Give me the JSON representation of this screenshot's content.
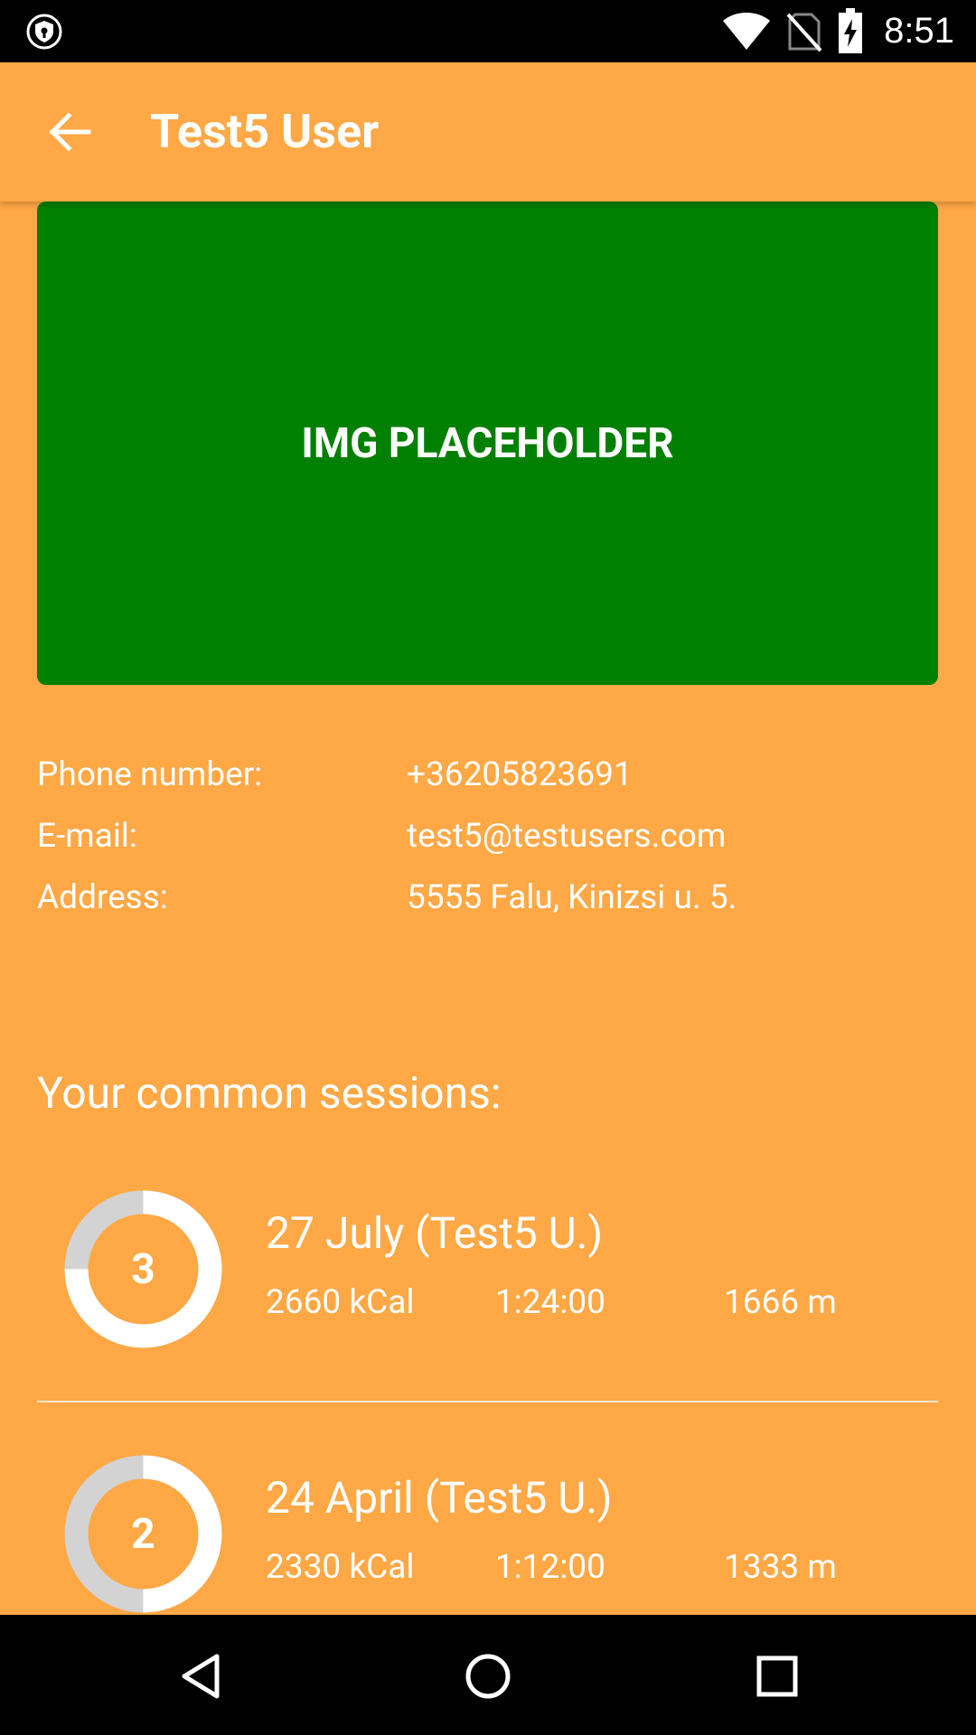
{
  "status_bar": {
    "time": "8:51"
  },
  "app_bar": {
    "title": "Test5 User"
  },
  "placeholder": {
    "label": "IMG PLACEHOLDER",
    "color": "#008000"
  },
  "contact": {
    "phone": {
      "label": "Phone number:",
      "value": "+36205823691"
    },
    "email": {
      "label": "E-mail:",
      "value": "test5@testusers.com"
    },
    "address": {
      "label": "Address:",
      "value": "5555 Falu, Kinizsi u. 5."
    }
  },
  "sessions_title": "Your common sessions:",
  "sessions": [
    {
      "count": "3",
      "title": "27 July (Test5 U.)",
      "kcal": "2660 kCal",
      "duration": "1:24:00",
      "distance": "1666 m"
    },
    {
      "count": "2",
      "title": "24 April (Test5 U.)",
      "kcal": "2330 kCal",
      "duration": "1:12:00",
      "distance": "1333 m"
    }
  ],
  "colors": {
    "background": "#FFA845",
    "accent": "#008000",
    "ring_filled": "#FFFFFF",
    "ring_empty": "#D3D3D3"
  }
}
